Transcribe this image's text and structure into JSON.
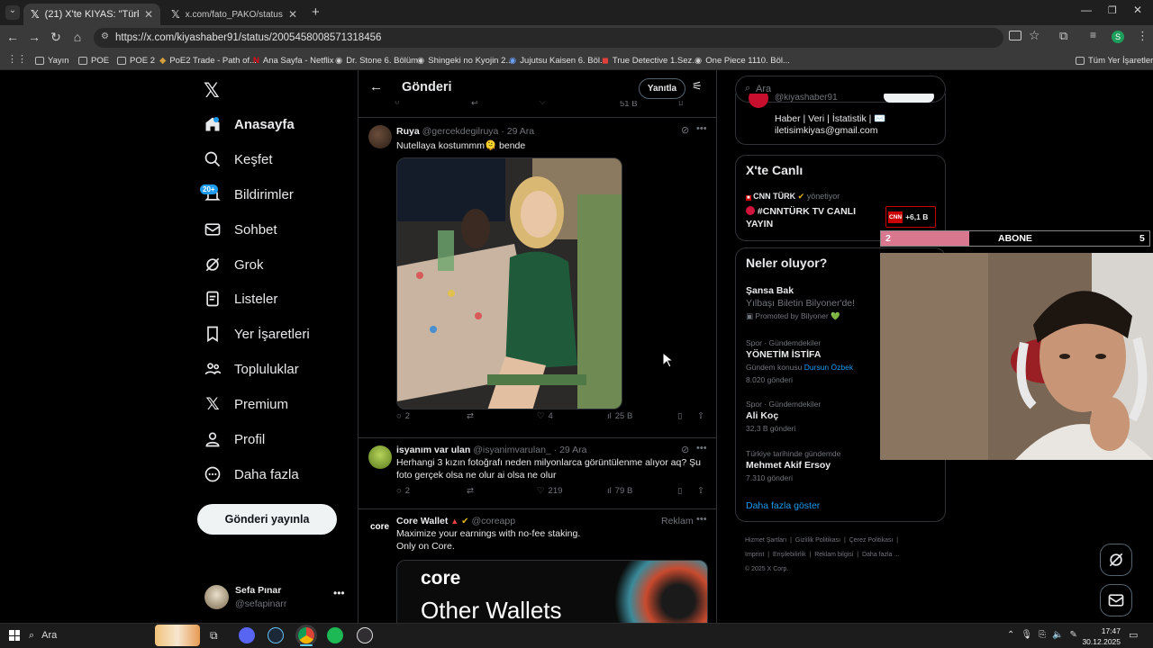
{
  "browser": {
    "tabs": [
      {
        "title": "(21) X'te KIYAS: \"Türkiye akşını\"",
        "active": true
      },
      {
        "title": "x.com/fato_PAKO/status/20057",
        "active": false
      }
    ],
    "url": "https://x.com/kiyashaber91/status/2005458008571318456",
    "profile_letter": "S",
    "bookmarks": [
      "Yayın",
      "POE",
      "POE 2",
      "PoE2 Trade - Path of...",
      "Ana Sayfa - Netflix",
      "Dr. Stone 6. Bölüm",
      "Shingeki no Kyojin 2...",
      "Jujutsu Kaisen 6. Böl...",
      "True Detective 1.Sez...",
      "One Piece 1110. Böl..."
    ],
    "all_bookmarks": "Tüm Yer İşaretleri"
  },
  "nav": {
    "items": [
      "Anasayfa",
      "Keşfet",
      "Bildirimler",
      "Sohbet",
      "Grok",
      "Listeler",
      "Yer İşaretleri",
      "Topluluklar",
      "Premium",
      "Profil",
      "Daha fazla"
    ],
    "notif_badge": "20+",
    "post_button": "Gönderi yayınla",
    "account": {
      "name": "Sefa Pınar",
      "handle": "@sefapinarr"
    }
  },
  "main": {
    "header": "Gönderi",
    "reply_button": "Yanıtla",
    "prev_views": "51 B",
    "tweets": [
      {
        "name": "Ruya",
        "handle": "@gercekdegilruya",
        "date": "· 29 Ara",
        "text": "Nutellaya kostummm🫠 bende",
        "replies": "2",
        "likes": "4",
        "views": "25 B"
      },
      {
        "name": "isyanım var ulan",
        "handle": "@isyanimvarulan_",
        "date": "· 29 Ara",
        "text": "Herhangi 3 kızın fotoğrafı neden milyonlarca görüntülenme alıyor aq? Şu foto gerçek olsa ne olur ai olsa ne olur",
        "replies": "2",
        "likes": "219",
        "views": "79 B"
      }
    ],
    "ad": {
      "name": "Core Wallet",
      "handle": "@coreapp",
      "label": "Reklam",
      "line1": "Maximize your earnings with no-fee staking.",
      "line2": "Only on Core.",
      "logo": "core",
      "banner_brand": "core",
      "banner_text": "Other Wallets"
    }
  },
  "right": {
    "search_placeholder": "Ara",
    "profile_handle": "@kiyashaber91",
    "bio_line1": "Haber | Veri | İstatistik | ✉️",
    "bio_line2": "iletisimkiyas@gmail.com",
    "live": {
      "title": "X'te Canlı",
      "host": "CNN TÜRK",
      "host_role": "yönetiyor",
      "live_title_line1": "#CNNTÜRK TV CANLI",
      "live_title_line2": "YAYIN",
      "listeners": "+6,1 B",
      "logo_text": "CNN"
    },
    "trends_title": "Neler oluyor?",
    "trends": [
      {
        "name": "Şansa Bak",
        "sub": "Yılbaşı Biletin Bilyoner'de!",
        "promo": "Promoted by Bilyoner 💚"
      },
      {
        "cat": "Spor · Gündemdekiler",
        "name": "YÖNETİM İSTİFA",
        "topic_label": "Gündem konusu",
        "topic": "Dursun Özbek",
        "count": "8.020 gönderi"
      },
      {
        "cat": "Spor · Gündemdekiler",
        "name": "Ali Koç",
        "count": "32,3 B gönderi"
      },
      {
        "cat": "Türkiye tarihinde gündemde",
        "name": "Mehmet Akif Ersoy",
        "count": "7.310 gönderi"
      }
    ],
    "show_more": "Daha fazla göster",
    "footer": [
      "Hizmet Şartları",
      "Gizlilik Politikası",
      "Çerez Politikası",
      "Imprint",
      "Erişilebilirlik",
      "Reklam bilgisi",
      "Daha fazla ...",
      "© 2025 X Corp."
    ]
  },
  "overlay": {
    "left_num": "2",
    "label": "ABONE",
    "right_num": "5",
    "progress": 0.33
  },
  "taskbar": {
    "search": "Ara",
    "time": "17:47",
    "date": "30.12.2025"
  },
  "colors": {
    "accent": "#1d9bf0",
    "pink": "#d9778f",
    "cnn_red": "#cc0000"
  }
}
